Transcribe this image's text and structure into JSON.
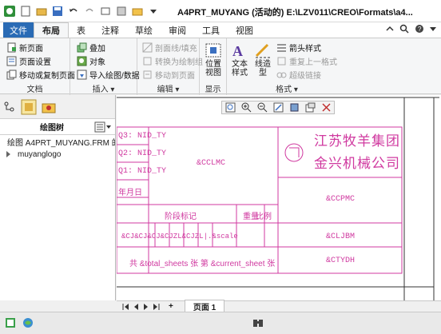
{
  "title": "A4PRT_MUYANG (活动的) E:\\LZV011\\CREO\\Formats\\a4...",
  "tabs": {
    "file": "文件",
    "layout": "布局",
    "table": "表",
    "annotate": "注释",
    "sketch": "草绘",
    "review": "审阅",
    "tools": "工具",
    "view": "视图"
  },
  "ribbon": {
    "doc": {
      "new_page": "新页面",
      "page_setup": "页面设置",
      "move_copy": "移动或复制页面",
      "label": "文档"
    },
    "insert": {
      "overlay": "叠加",
      "object": "对象",
      "import": "导入绘图/数据",
      "label": "插入"
    },
    "edit": {
      "hatch": "剖面线/填充",
      "convert": "转换为绘制组",
      "move_to_page": "移动到页面",
      "label": "编辑"
    },
    "display": {
      "pos_view_1": "位置",
      "pos_view_2": "视图",
      "label": "显示"
    },
    "format": {
      "text_style_1": "文本",
      "text_style_2": "样式",
      "line_style_1": "线造",
      "line_style_2": "型",
      "arrow_style": "箭头样式",
      "repeat_format": "重复上一格式",
      "hyperlink": "超级链接",
      "label": "格式"
    }
  },
  "left_panel": {
    "tree_title": "绘图树",
    "items": [
      "绘图 A4PRT_MUYANG.FRM 的",
      "muyanglogo"
    ]
  },
  "drawing": {
    "rev_rows": [
      "Q3: NID_TY",
      "Q2: NID_TY",
      "Q1: NID_TY",
      "年月日"
    ],
    "cclmc": "&CCLMC",
    "company_1": "江苏牧羊集团",
    "company_2": "金兴机械公司",
    "ccpmc": "&CCPMC",
    "stage_mark": "阶段标记",
    "weight": "重量",
    "scale_label": "比例",
    "params_row": "&CJ&CJ&CJ&CJZL&CJZL|.&scale",
    "scale_value": "&scale",
    "cljbm": "&CLJBM",
    "sheets": "共  &total_sheets  张    第  &current_sheet  张",
    "ctydh": "&CTYDH"
  },
  "pagebar": {
    "page_label": "页面 1"
  }
}
